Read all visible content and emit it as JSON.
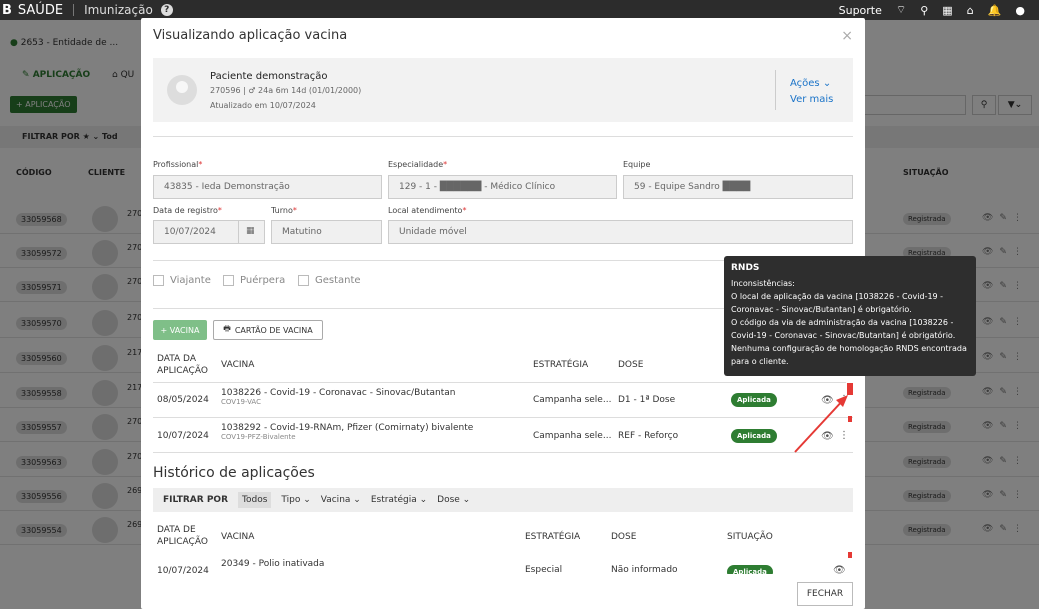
{
  "topbar": {
    "brand": "B",
    "app": "SAÚDE",
    "module": "Imunização",
    "help": "?",
    "right": [
      "Suporte",
      "wifi",
      "search",
      "grid",
      "home",
      "bell"
    ]
  },
  "bg": {
    "unit": "2653 - Entidade de ...",
    "tab_aplicacao": "APLICAÇÃO",
    "tab_other": "QU",
    "add_button": "+ APLICAÇÃO",
    "filter": "FILTRAR POR",
    "filter_value": "Tod",
    "headers": {
      "codigo": "CÓDIGO",
      "cliente": "CLIENTE",
      "situacao": "SITUAÇÃO"
    },
    "codes": [
      "33059568",
      "33059572",
      "33059571",
      "33059570",
      "33059560",
      "33059558",
      "33059557",
      "33059563",
      "33059556",
      "33059554"
    ],
    "status": "Registrada",
    "partial_numbers": [
      "270",
      "270",
      "270",
      "270",
      "217",
      "217",
      "270",
      "270",
      "269",
      "269"
    ]
  },
  "modal": {
    "title": "Visualizando aplicação vacina",
    "close": "×",
    "patient": {
      "name": "Paciente demonstração",
      "info": "270596 | ♂ 24a 6m 14d (01/01/2000)",
      "updated": "Atualizado em 10/07/2024",
      "actions": "Ações ⌄",
      "see_more": "Ver mais"
    },
    "form": {
      "profissional_label": "Profissional",
      "profissional_value": "43835 - Ieda Demonstração",
      "especialidade_label": "Especialidade",
      "especialidade_value": "129 - 1 - ██████ - Médico Clínico",
      "equipe_label": "Equipe",
      "equipe_value": "59 - Equipe Sandro ████",
      "data_label": "Data de registro",
      "data_value": "10/07/2024",
      "turno_label": "Turno",
      "turno_value": "Matutino",
      "local_label": "Local atendimento",
      "local_value": "Unidade móvel"
    },
    "checkboxes": [
      "Viajante",
      "Puérpera",
      "Gestante"
    ],
    "buttons": {
      "vacina": "+ VACINA",
      "cartao": "CARTÃO DE VACINA"
    },
    "table": {
      "headers": {
        "data": "DATA DA APLICAÇÃO",
        "vacina": "VACINA",
        "estrategia": "ESTRATÉGIA",
        "dose": "DOSE"
      },
      "rows": [
        {
          "date": "08/05/2024",
          "vaccine": "1038226 - Covid-19 - Coronavac - Sinovac/Butantan",
          "code": "COV19-VAC",
          "strategy": "Campanha sele...",
          "dose": "D1 - 1ª Dose",
          "status": "Aplicada"
        },
        {
          "date": "10/07/2024",
          "vaccine": "1038292 - Covid-19-RNAm, Pfizer (Comirnaty) bivalente",
          "code": "COV19-PFZ-Bivalente",
          "strategy": "Campanha sele...",
          "dose": "REF - Reforço",
          "status": "Aplicada"
        }
      ]
    },
    "history": {
      "title": "Histórico de aplicações",
      "filter_label": "FILTRAR POR",
      "filters": [
        "Todos",
        "Tipo ⌄",
        "Vacina ⌄",
        "Estratégia ⌄",
        "Dose ⌄"
      ],
      "headers": {
        "data": "DATA DE APLICAÇÃO",
        "vacina": "VACINA",
        "estrategia": "ESTRATÉGIA",
        "dose": "DOSE",
        "situacao": "SITUAÇÃO"
      },
      "row": {
        "date": "10/07/2024",
        "vaccine": "20349 - Polio inativada",
        "strategy": "Especial",
        "dose": "Não informado",
        "status": "Aplicada"
      }
    },
    "close_button": "FECHAR"
  },
  "tooltip": {
    "title": "RNDS",
    "lines": [
      "Inconsistências:",
      "O local de aplicação da vacina [1038226 - Covid-19 - Coronavac - Sinovac/Butantan] é obrigatório.",
      "O código da via de administração da vacina [1038226 - Covid-19 - Coronavac - Sinovac/Butantan] é obrigatório.",
      "Nenhuma configuração de homologação RNDS encontrada para o cliente."
    ]
  },
  "colors": {
    "green": "#2e7d32",
    "dark": "#2c2c2c",
    "link": "#1a73c8",
    "alert": "#e53935"
  }
}
